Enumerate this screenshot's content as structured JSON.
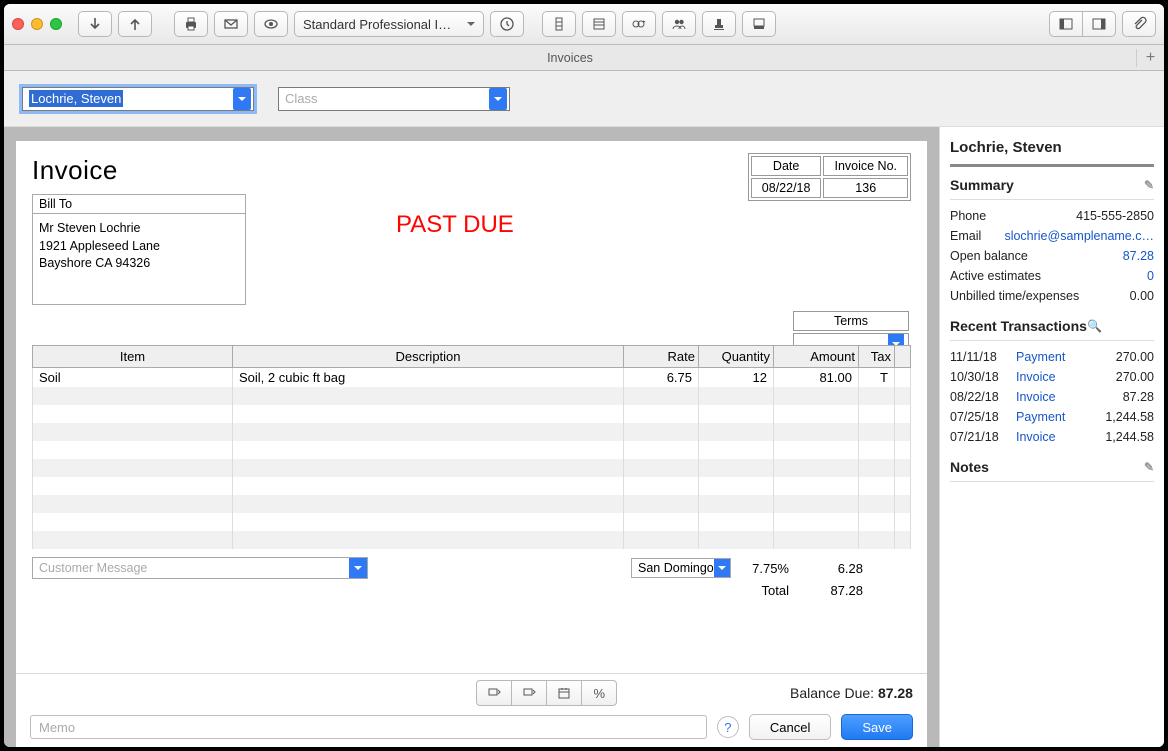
{
  "window": {
    "tab_title": "Invoices"
  },
  "toolbar": {
    "template_select": "Standard Professional I…"
  },
  "header": {
    "customer_value": "Lochrie, Steven",
    "class_placeholder": "Class"
  },
  "invoice": {
    "title": "Invoice",
    "watermark": "PAST DUE",
    "date_label": "Date",
    "date_value": "08/22/18",
    "invoice_no_label": "Invoice No.",
    "invoice_no_value": "136",
    "bill_to_label": "Bill To",
    "bill_to_line1": "Mr Steven Lochrie",
    "bill_to_line2": "1921 Appleseed Lane",
    "bill_to_line3": "Bayshore CA 94326",
    "terms_label": "Terms",
    "columns": {
      "item": "Item",
      "description": "Description",
      "rate": "Rate",
      "quantity": "Quantity",
      "amount": "Amount",
      "tax": "Tax"
    },
    "lines": [
      {
        "item": "Soil",
        "description": "Soil, 2 cubic ft bag",
        "rate": "6.75",
        "quantity": "12",
        "amount": "81.00",
        "tax": "T"
      }
    ],
    "customer_message_placeholder": "Customer Message",
    "tax_name": "San Domingo",
    "tax_rate": "7.75%",
    "tax_amount": "6.28",
    "total_label": "Total",
    "total_amount": "87.28"
  },
  "footer": {
    "balance_due_label": "Balance Due:",
    "balance_due_value": "87.28",
    "memo_placeholder": "Memo",
    "cancel": "Cancel",
    "save": "Save"
  },
  "sidebar": {
    "name": "Lochrie, Steven",
    "summary_label": "Summary",
    "phone_label": "Phone",
    "phone_value": "415-555-2850",
    "email_label": "Email",
    "email_value": "slochrie@samplename.c…",
    "open_balance_label": "Open balance",
    "open_balance_value": "87.28",
    "active_estimates_label": "Active estimates",
    "active_estimates_value": "0",
    "unbilled_label": "Unbilled time/expenses",
    "unbilled_value": "0.00",
    "recent_label": "Recent Transactions",
    "transactions": [
      {
        "date": "11/11/18",
        "type": "Payment",
        "amount": "270.00"
      },
      {
        "date": "10/30/18",
        "type": "Invoice",
        "amount": "270.00"
      },
      {
        "date": "08/22/18",
        "type": "Invoice",
        "amount": "87.28"
      },
      {
        "date": "07/25/18",
        "type": "Payment",
        "amount": "1,244.58"
      },
      {
        "date": "07/21/18",
        "type": "Invoice",
        "amount": "1,244.58"
      }
    ],
    "notes_label": "Notes"
  }
}
